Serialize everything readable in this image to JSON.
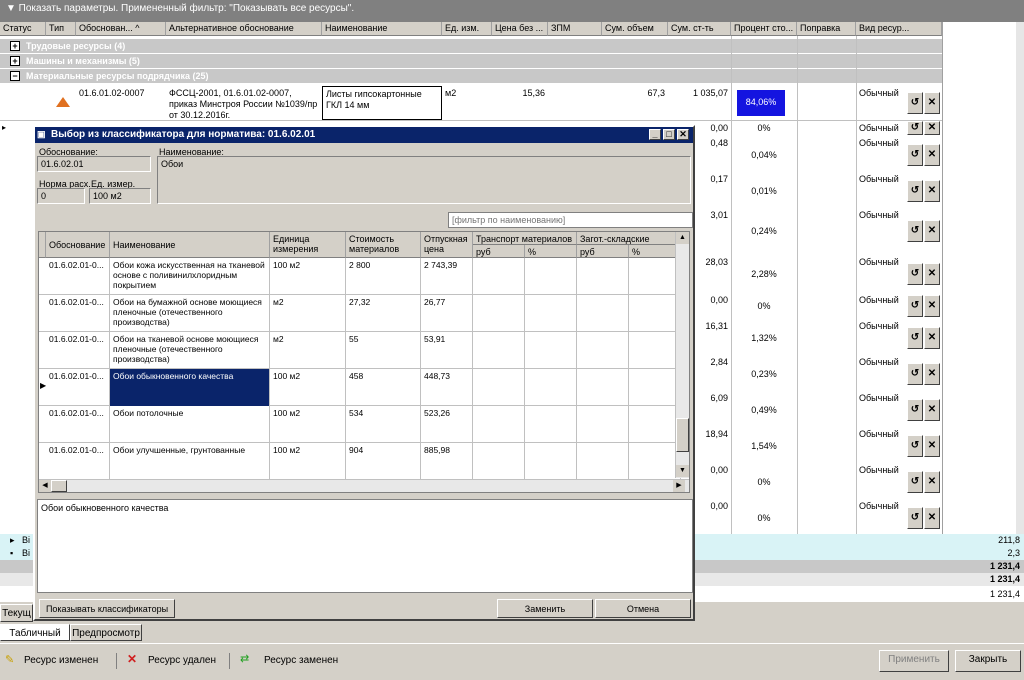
{
  "filter_bar": "▼  Показать параметры. Примененный фильтр: \"Показывать все ресурсы\".",
  "grid": {
    "headers": [
      "Статус",
      "Тип",
      "Обоснован... ^",
      "Альтернативное обоснование",
      "Наименование",
      "Ед. изм.",
      "Цена без ...",
      "ЗПМ",
      "Сум. объем",
      "Сум. ст-ть",
      "Процент сто...",
      "Поправка",
      "Вид ресур..."
    ],
    "groups": [
      "Трудовые ресурсы (4)",
      "Машины и механизмы (5)",
      "Материальные ресурсы подрядчика (25)"
    ],
    "first_row": {
      "code": "01.6.01.02-0007",
      "alt": "ФССЦ-2001, 01.6.01.02-0007, приказ Минстроя России №1039/пр от 30.12.2016г.",
      "name": "Листы гипсокартонные ГКЛ 14 мм",
      "unit": "м2",
      "price": "15,36",
      "sum_volume": "67,3",
      "sum_cost": "1 035,07",
      "percent": "84,06%",
      "kind": "Обычный"
    },
    "rows": [
      {
        "sum_cost": "0,00",
        "percent": "0%",
        "kind": "Обычный"
      },
      {
        "sum_cost": "0,48",
        "percent": "0,04%",
        "kind": "Обычный"
      },
      {
        "sum_cost": "0,17",
        "percent": "0,01%",
        "kind": "Обычный"
      },
      {
        "sum_cost": "3,01",
        "percent": "0,24%",
        "kind": "Обычный"
      },
      {
        "sum_cost": "28,03",
        "percent": "2,28%",
        "kind": "Обычный"
      },
      {
        "sum_cost": "0,00",
        "percent": "0%",
        "kind": "Обычный"
      },
      {
        "sum_cost": "16,31",
        "percent": "1,32%",
        "kind": "Обычный"
      },
      {
        "sum_cost": "2,84",
        "percent": "0,23%",
        "kind": "Обычный"
      },
      {
        "sum_cost": "6,09",
        "percent": "0,49%",
        "kind": "Обычный"
      },
      {
        "sum_cost": "18,94",
        "percent": "1,54%",
        "kind": "Обычный"
      },
      {
        "sum_cost": "0,00",
        "percent": "0%",
        "kind": "Обычный"
      },
      {
        "sum_cost": "0,00",
        "percent": "0%",
        "kind": "Обычный"
      }
    ],
    "summary": [
      "211,8",
      "2,3",
      "1 231,4",
      "1 231,4",
      "1 231,4"
    ],
    "summary_labels": [
      "Ві",
      "Ві"
    ]
  },
  "dialog": {
    "title": "Выбор из классификатора для норматива: 01.6.02.01",
    "basis_label": "Обоснование:",
    "basis_value": "01.6.02.01",
    "name_label": "Наименование:",
    "name_value": "Обои",
    "norm_label": "Норма расх.",
    "norm_value": "0",
    "unit_label": "Ед. измер.",
    "unit_value": "100 м2",
    "filter_placeholder": "[фильтр по наименованию]",
    "columns": {
      "code": "Обоснование",
      "name": "Наименование",
      "unit": "Единица измерения",
      "cost": "Стоимость материалов",
      "release": "Отпускная цена",
      "transport": "Транспорт материалов",
      "storage": "Загот.-складские",
      "rub": "руб",
      "pct": "%"
    },
    "rows": [
      {
        "code": "01.6.02.01-0...",
        "name": "Обои кожа искусственная на тканевой основе с поливинилхлоридным покрытием",
        "unit": "100 м2",
        "cost": "2 800",
        "release": "2 743,39"
      },
      {
        "code": "01.6.02.01-0...",
        "name": "Обои на бумажной основе моющиеся пленочные (отечественного производства)",
        "unit": "м2",
        "cost": "27,32",
        "release": "26,77"
      },
      {
        "code": "01.6.02.01-0...",
        "name": "Обои на тканевой основе моющиеся пленочные (отечественного производства)",
        "unit": "м2",
        "cost": "55",
        "release": "53,91"
      },
      {
        "code": "01.6.02.01-0...",
        "name": "Обои обыкновенного качества",
        "unit": "100 м2",
        "cost": "458",
        "release": "448,73"
      },
      {
        "code": "01.6.02.01-0...",
        "name": "Обои потолочные",
        "unit": "100 м2",
        "cost": "534",
        "release": "523,26"
      },
      {
        "code": "01.6.02.01-0...",
        "name": "Обои улучшенные, грунтованные",
        "unit": "100 м2",
        "cost": "904",
        "release": "885,98"
      }
    ],
    "description": "Обои обыкновенного качества",
    "show_classifiers": "Показывать классификаторы",
    "replace": "Заменить",
    "cancel": "Отмена"
  },
  "tabs": [
    "Текущ",
    "Табличный вид",
    "Предпросмотр"
  ],
  "status": {
    "changed": "Ресурс изменен",
    "deleted": "Ресурс удален",
    "replaced": "Ресурс заменен",
    "apply": "Применить",
    "close": "Закрыть"
  },
  "colors": {
    "selection": "#0a246a",
    "title": "#0a246a",
    "summary": "#d9f3f6"
  }
}
